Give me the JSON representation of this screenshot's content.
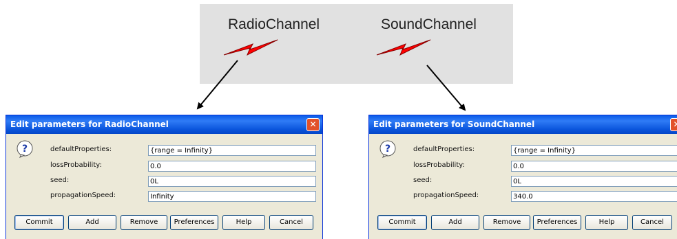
{
  "library": {
    "radio_label": "RadioChannel",
    "sound_label": "SoundChannel",
    "bolt_color": "#ff0000"
  },
  "dialogs": [
    {
      "title": "Edit parameters for RadioChannel",
      "close_glyph": "✕",
      "params": [
        {
          "label": "defaultProperties:",
          "value": "{range = Infinity}"
        },
        {
          "label": "lossProbability:",
          "value": "0.0"
        },
        {
          "label": "seed:",
          "value": "0L"
        },
        {
          "label": "propagationSpeed:",
          "value": "Infinity"
        }
      ],
      "buttons": [
        "Commit",
        "Add",
        "Remove",
        "Preferences",
        "Help",
        "Cancel"
      ]
    },
    {
      "title": "Edit parameters for SoundChannel",
      "close_glyph": "✕",
      "params": [
        {
          "label": "defaultProperties:",
          "value": "{range = Infinity}"
        },
        {
          "label": "lossProbability:",
          "value": "0.0"
        },
        {
          "label": "seed:",
          "value": "0L"
        },
        {
          "label": "propagationSpeed:",
          "value": "340.0"
        }
      ],
      "buttons": [
        "Commit",
        "Add",
        "Remove",
        "Preferences",
        "Help",
        "Cancel"
      ]
    }
  ]
}
